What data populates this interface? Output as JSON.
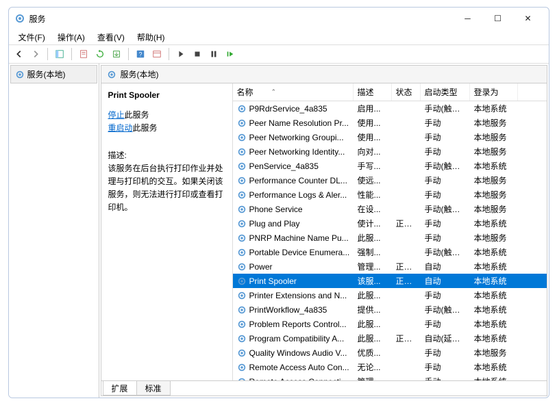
{
  "window": {
    "title": "服务"
  },
  "menu": {
    "file": "文件(F)",
    "action": "操作(A)",
    "view": "查看(V)",
    "help": "帮助(H)"
  },
  "nav": {
    "local": "服务(本地)"
  },
  "main_header": "服务(本地)",
  "detail": {
    "service_name": "Print Spooler",
    "stop_link": "停止",
    "stop_suffix": "此服务",
    "restart_link": "重启动",
    "restart_suffix": "此服务",
    "desc_label": "描述:",
    "desc_text": "该服务在后台执行打印作业并处理与打印机的交互。如果关闭该服务，则无法进行打印或查看打印机。"
  },
  "columns": {
    "name": "名称",
    "desc": "描述",
    "status": "状态",
    "start": "启动类型",
    "logon": "登录为"
  },
  "tabs": {
    "extended": "扩展",
    "standard": "标准"
  },
  "rows": [
    {
      "name": "P9RdrService_4a835",
      "desc": "启用...",
      "status": "",
      "start": "手动(触发...",
      "logon": "本地系统"
    },
    {
      "name": "Peer Name Resolution Pr...",
      "desc": "使用...",
      "status": "",
      "start": "手动",
      "logon": "本地服务"
    },
    {
      "name": "Peer Networking Groupi...",
      "desc": "使用...",
      "status": "",
      "start": "手动",
      "logon": "本地服务"
    },
    {
      "name": "Peer Networking Identity...",
      "desc": "向对...",
      "status": "",
      "start": "手动",
      "logon": "本地服务"
    },
    {
      "name": "PenService_4a835",
      "desc": "手写...",
      "status": "",
      "start": "手动(触发...",
      "logon": "本地系统"
    },
    {
      "name": "Performance Counter DL...",
      "desc": "使远...",
      "status": "",
      "start": "手动",
      "logon": "本地服务"
    },
    {
      "name": "Performance Logs & Aler...",
      "desc": "性能...",
      "status": "",
      "start": "手动",
      "logon": "本地服务"
    },
    {
      "name": "Phone Service",
      "desc": "在设...",
      "status": "",
      "start": "手动(触发...",
      "logon": "本地服务"
    },
    {
      "name": "Plug and Play",
      "desc": "使计...",
      "status": "正在...",
      "start": "手动",
      "logon": "本地系统"
    },
    {
      "name": "PNRP Machine Name Pu...",
      "desc": "此服...",
      "status": "",
      "start": "手动",
      "logon": "本地服务"
    },
    {
      "name": "Portable Device Enumera...",
      "desc": "强制...",
      "status": "",
      "start": "手动(触发...",
      "logon": "本地系统"
    },
    {
      "name": "Power",
      "desc": "管理...",
      "status": "正在...",
      "start": "自动",
      "logon": "本地系统"
    },
    {
      "name": "Print Spooler",
      "desc": "该服...",
      "status": "正在...",
      "start": "自动",
      "logon": "本地系统",
      "selected": true
    },
    {
      "name": "Printer Extensions and N...",
      "desc": "此服...",
      "status": "",
      "start": "手动",
      "logon": "本地系统"
    },
    {
      "name": "PrintWorkflow_4a835",
      "desc": "提供...",
      "status": "",
      "start": "手动(触发...",
      "logon": "本地系统"
    },
    {
      "name": "Problem Reports Control...",
      "desc": "此服...",
      "status": "",
      "start": "手动",
      "logon": "本地系统"
    },
    {
      "name": "Program Compatibility A...",
      "desc": "此服...",
      "status": "正在...",
      "start": "自动(延迟...",
      "logon": "本地系统"
    },
    {
      "name": "Quality Windows Audio V...",
      "desc": "优质...",
      "status": "",
      "start": "手动",
      "logon": "本地服务"
    },
    {
      "name": "Remote Access Auto Con...",
      "desc": "无论...",
      "status": "",
      "start": "手动",
      "logon": "本地系统"
    },
    {
      "name": "Remote Access Connecti...",
      "desc": "管理...",
      "status": "",
      "start": "手动",
      "logon": "本地系统"
    }
  ]
}
